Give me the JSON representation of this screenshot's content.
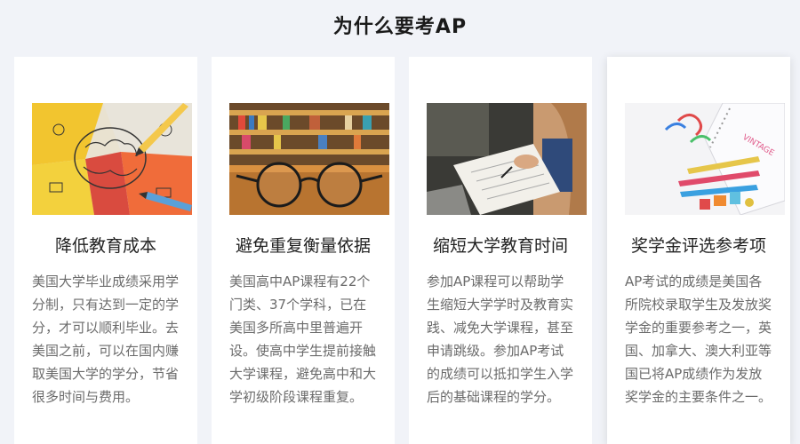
{
  "header": {
    "title": "为什么要考AP"
  },
  "cards": [
    {
      "image_label": "brain-puzzle-pencils-image",
      "title": "降低教育成本",
      "description": "美国大学毕业成绩采用学分制，只有达到一定的学分，才可以顺利毕业。去美国之前，可以在国内赚取美国大学的学分，节省很多时间与费用。"
    },
    {
      "image_label": "glasses-library-image",
      "title": "避免重复衡量依据",
      "description": "美国高中AP课程有22个门类、37个学科，已在美国多所高中里普遍开设。使高中学生提前接触大学课程，避免高中和大学初级阶段课程重复。"
    },
    {
      "image_label": "student-writing-notebook-image",
      "title": "缩短大学教育时间",
      "description": "参加AP课程可以帮助学生缩短大学学时及教育实践、减免大学课程，甚至申请跳级。参加AP考试的成绩可以抵扣学生入学后的基础课程的学分。"
    },
    {
      "image_label": "stationery-notebook-image",
      "title": "奖学金评选参考项",
      "description": "AP考试的成绩是美国各所院校录取学生及发放奖学金的重要参考之一，英国、加拿大、澳大利亚等国已将AP成绩作为发放奖学金的主要条件之一。"
    }
  ]
}
